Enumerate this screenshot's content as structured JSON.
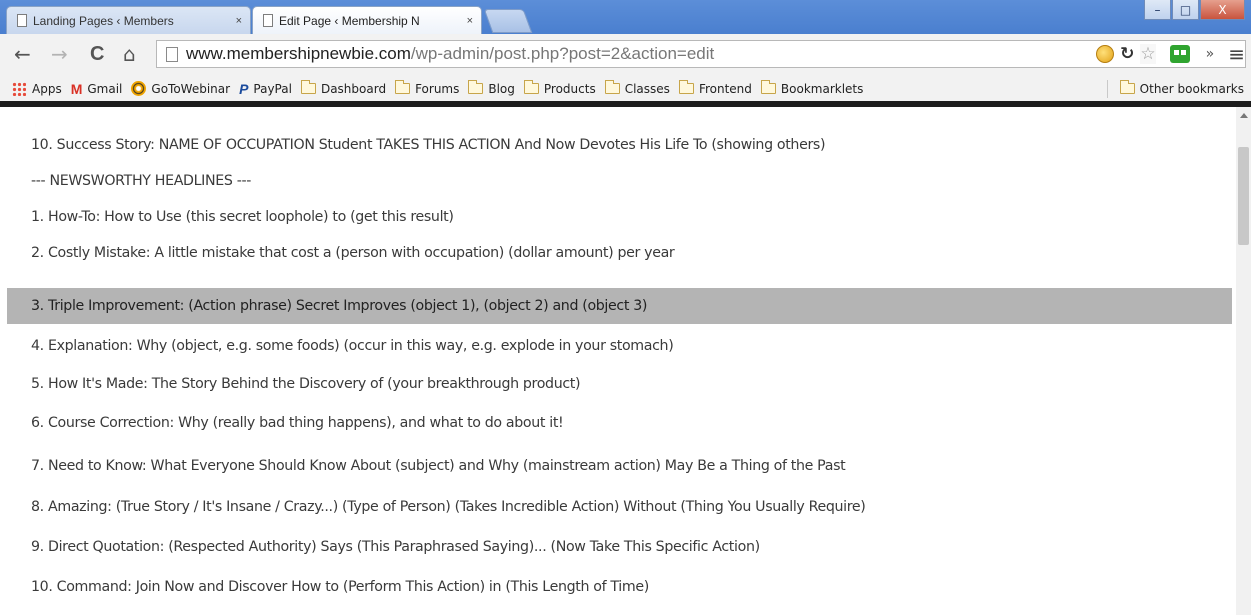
{
  "browser": {
    "tabs": [
      {
        "label": "Landing Pages ‹ Members",
        "close": "×",
        "active": false
      },
      {
        "label": "Edit Page ‹ Membership N",
        "close": "×",
        "active": true
      }
    ],
    "window_controls": {
      "minimize": "–",
      "maximize": "□",
      "close": "X"
    },
    "nav": {
      "back": "←",
      "forward": "→",
      "reload": "C",
      "home": "⌂"
    },
    "url": {
      "host": "www.membershipnewbie.com",
      "path": "/wp-admin/post.php?post=2&action=edit"
    },
    "toolbar_icons": [
      "emoji-extension-icon",
      "sync-icon",
      "star-icon",
      "green-robot-extension-icon",
      "overflow-chevron-icon",
      "menu-icon"
    ],
    "toolbar_glyphs": {
      "sync": "↻",
      "star": "☆",
      "overflow": "»",
      "menu": "≡"
    }
  },
  "bookmarks": [
    {
      "label": "Apps",
      "icon": "apps-grid-icon"
    },
    {
      "label": "Gmail",
      "icon": "gmail-icon"
    },
    {
      "label": "GoToWebinar",
      "icon": "gotowebinar-icon"
    },
    {
      "label": "PayPal",
      "icon": "paypal-icon"
    },
    {
      "label": "Dashboard",
      "icon": "folder-icon"
    },
    {
      "label": "Forums",
      "icon": "folder-icon"
    },
    {
      "label": "Blog",
      "icon": "folder-icon"
    },
    {
      "label": "Products",
      "icon": "folder-icon"
    },
    {
      "label": "Classes",
      "icon": "folder-icon"
    },
    {
      "label": "Frontend",
      "icon": "folder-icon"
    },
    {
      "label": "Bookmarklets",
      "icon": "folder-icon"
    }
  ],
  "other_bookmarks": "Other bookmarks",
  "content": {
    "lines": [
      {
        "text": "10. Success Story: NAME OF OCCUPATION Student TAKES THIS ACTION And Now Devotes His Life To (showing others)",
        "highlighted": false
      },
      {
        "text": "--- NEWSWORTHY HEADLINES ---",
        "highlighted": false
      },
      {
        "text": "1. How-To: How to Use (this secret loophole) to (get this result)",
        "highlighted": false
      },
      {
        "text": "2. Costly Mistake: A little mistake that cost a (person with occupation) (dollar amount) per year",
        "highlighted": false
      },
      {
        "text": "3. Triple Improvement: (Action phrase) Secret Improves (object 1), (object 2) and (object 3)",
        "highlighted": true
      },
      {
        "text": "4. Explanation: Why (object, e.g. some foods) (occur in this way, e.g. explode in your stomach)",
        "highlighted": false
      },
      {
        "text": "5. How It's Made: The Story Behind the Discovery of (your breakthrough product)",
        "highlighted": false
      },
      {
        "text": "6. Course Correction: Why (really bad thing happens), and what to do about it!",
        "highlighted": false
      },
      {
        "text": "7. Need to Know: What Everyone Should Know About (subject) and Why (mainstream action) May Be a Thing of the Past",
        "highlighted": false
      },
      {
        "text": "8. Amazing: (True Story / It's Insane / Crazy...) (Type of Person) (Takes Incredible Action) Without (Thing You Usually Require)",
        "highlighted": false
      },
      {
        "text": "9. Direct Quotation: (Respected Authority) Says (This Paraphrased Saying)... (Now Take This Specific Action)",
        "highlighted": false
      },
      {
        "text": "10. Command: Join Now and Discover How to (Perform This Action) in (This Length of Time)",
        "highlighted": false
      }
    ]
  },
  "colors": {
    "title_bar": "#4a7fcf",
    "highlight_row": "#b4b4b4",
    "body_text": "#3a3a3a"
  }
}
